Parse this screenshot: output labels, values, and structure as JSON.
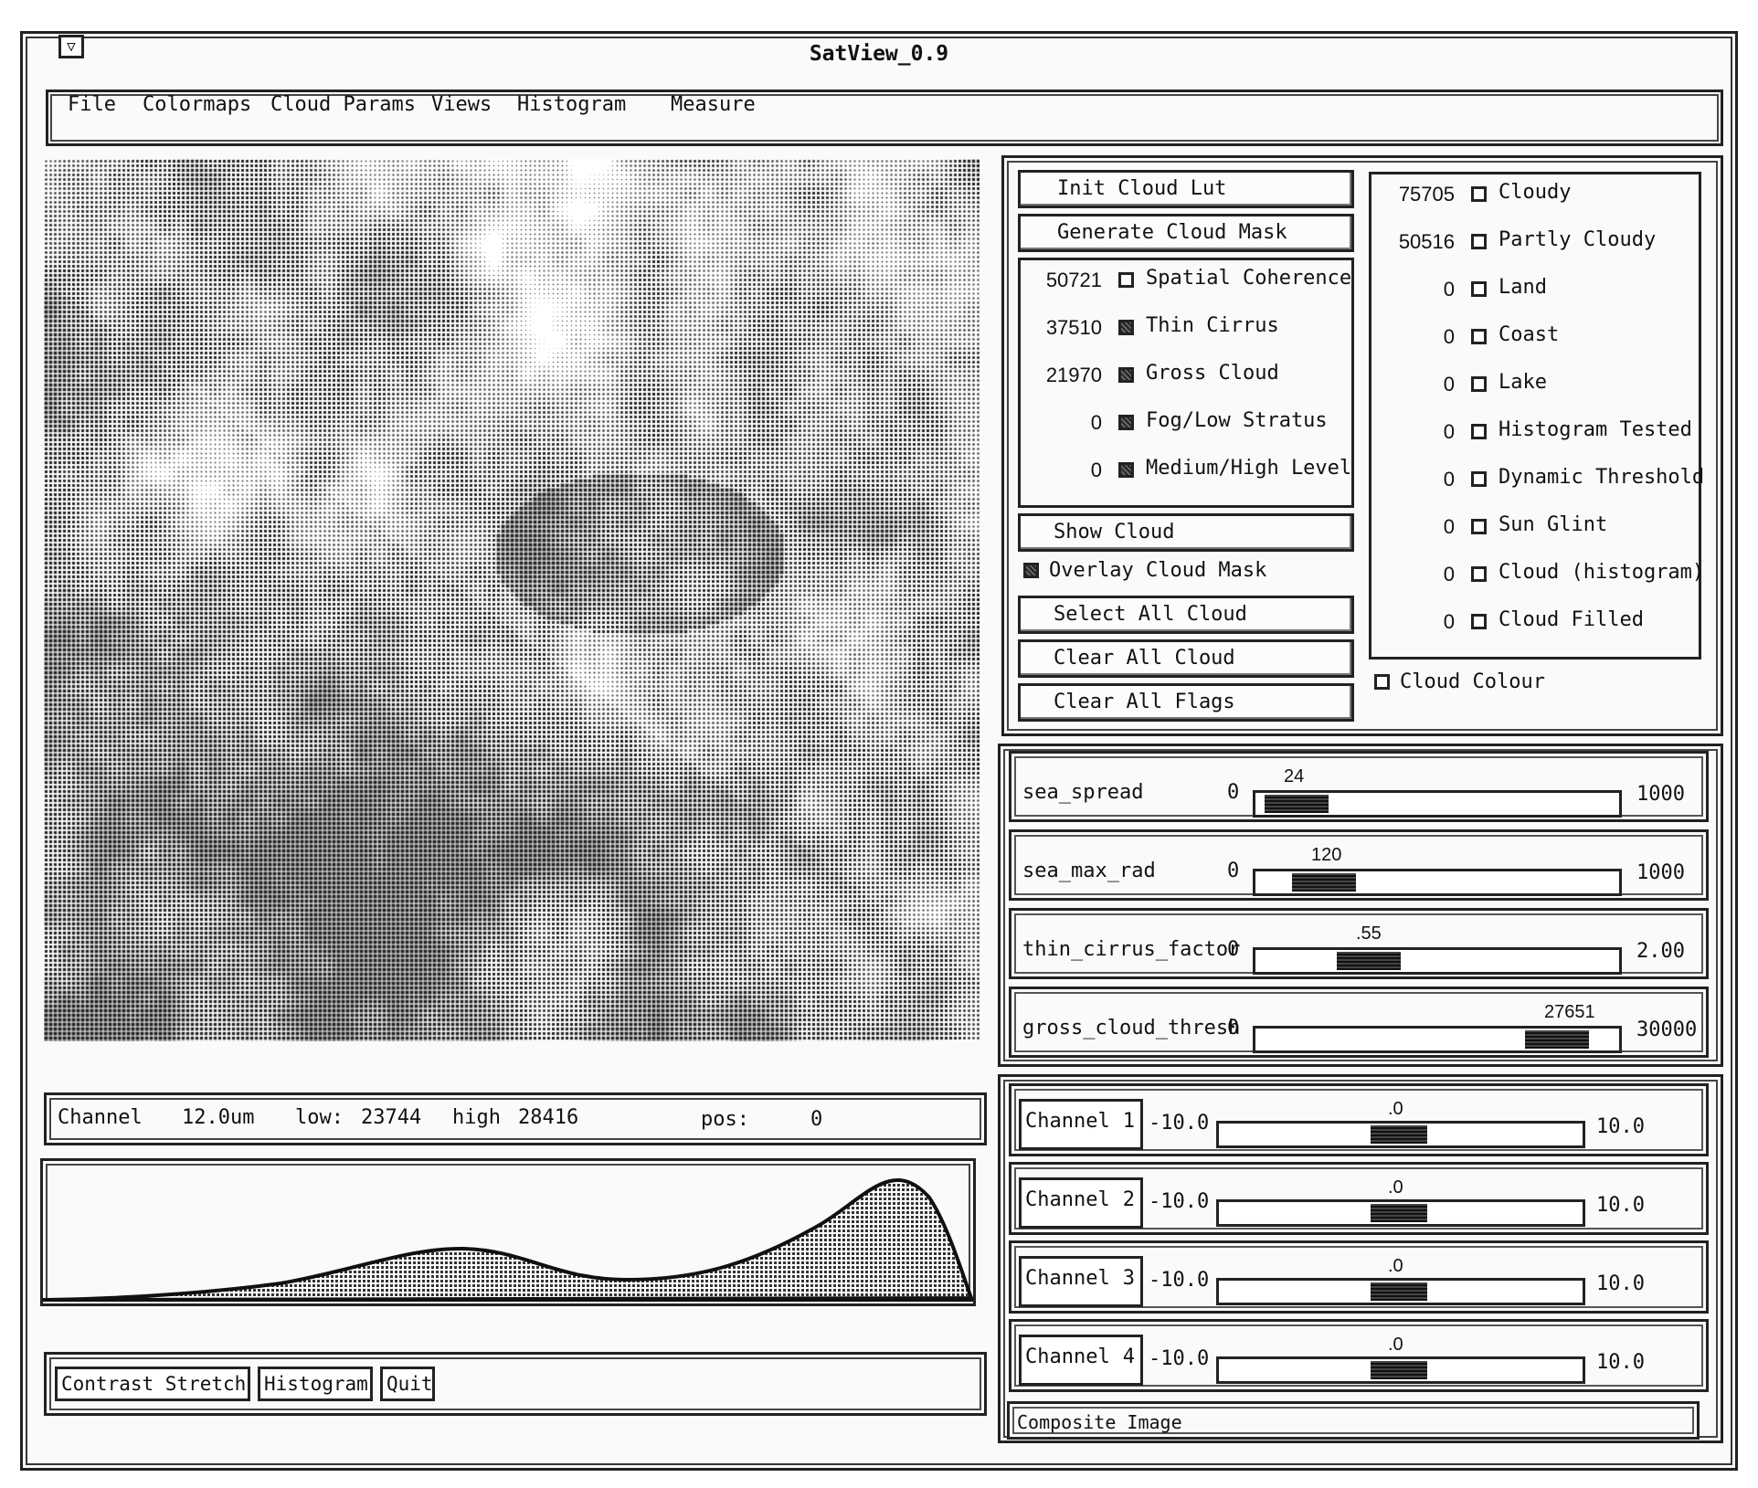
{
  "window": {
    "title": "SatView_0.9",
    "menu_icon": "window-menu-icon"
  },
  "menu": [
    "File",
    "Colormaps",
    "Cloud Params",
    "Views",
    "Histogram",
    "Measure"
  ],
  "cloud_buttons": {
    "init": "Init Cloud Lut",
    "generate": "Generate Cloud Mask",
    "show": "Show Cloud",
    "select_all": "Select All Cloud",
    "clear_all": "Clear All Cloud",
    "clear_flags": "Clear All Flags"
  },
  "tests": [
    {
      "count": "50721",
      "label": "Spatial Coherence",
      "checked": false
    },
    {
      "count": "37510",
      "label": "Thin Cirrus",
      "checked": true
    },
    {
      "count": "21970",
      "label": "Gross Cloud",
      "checked": true
    },
    {
      "count": "0",
      "label": "Fog/Low Stratus",
      "checked": true
    },
    {
      "count": "0",
      "label": "Medium/High Level",
      "checked": true
    }
  ],
  "overlay": {
    "label": "Overlay Cloud Mask",
    "checked": true
  },
  "flags": [
    {
      "count": "75705",
      "label": "Cloudy",
      "checked": false
    },
    {
      "count": "50516",
      "label": "Partly Cloudy",
      "checked": false
    },
    {
      "count": "0",
      "label": "Land",
      "checked": false
    },
    {
      "count": "0",
      "label": "Coast",
      "checked": false
    },
    {
      "count": "0",
      "label": "Lake",
      "checked": false
    },
    {
      "count": "0",
      "label": "Histogram Tested",
      "checked": false
    },
    {
      "count": "0",
      "label": "Dynamic Threshold",
      "checked": false
    },
    {
      "count": "0",
      "label": "Sun Glint",
      "checked": false
    },
    {
      "count": "0",
      "label": "Cloud (histogram)",
      "checked": false
    },
    {
      "count": "0",
      "label": "Cloud Filled",
      "checked": false
    }
  ],
  "cloud_colour": {
    "label": "Cloud Colour",
    "checked": false
  },
  "params": [
    {
      "name": "sea_spread",
      "min": "0",
      "max": "1000",
      "value": "24",
      "fraction": 0.024
    },
    {
      "name": "sea_max_rad",
      "min": "0",
      "max": "1000",
      "value": "120",
      "fraction": 0.12
    },
    {
      "name": "thin_cirrus_factor",
      "min": "0",
      "max": "2.00",
      "value": ".55",
      "fraction": 0.275
    },
    {
      "name": "gross_cloud_thresh",
      "min": "0",
      "max": "30000",
      "value": "27651",
      "fraction": 0.9217
    }
  ],
  "channels": [
    {
      "label": "Channel",
      "num": "1",
      "min": "-10.0",
      "max": "10.0",
      "value": ".0",
      "fraction": 0.5
    },
    {
      "label": "Channel",
      "num": "2",
      "min": "-10.0",
      "max": "10.0",
      "value": ".0",
      "fraction": 0.5
    },
    {
      "label": "Channel",
      "num": "3",
      "min": "-10.0",
      "max": "10.0",
      "value": ".0",
      "fraction": 0.5
    },
    {
      "label": "Channel",
      "num": "4",
      "min": "-10.0",
      "max": "10.0",
      "value": ".0",
      "fraction": 0.5
    }
  ],
  "composite": "Composite Image",
  "status": {
    "channel_label": "Channel",
    "channel_value": "12.0um",
    "low_label": "low:",
    "low_value": "23744",
    "high_label": "high",
    "high_value": "28416",
    "pos_label": "pos:",
    "pos_value": "0"
  },
  "bottom_buttons": [
    "Contrast Stretch",
    "Histogram",
    "Quit"
  ]
}
